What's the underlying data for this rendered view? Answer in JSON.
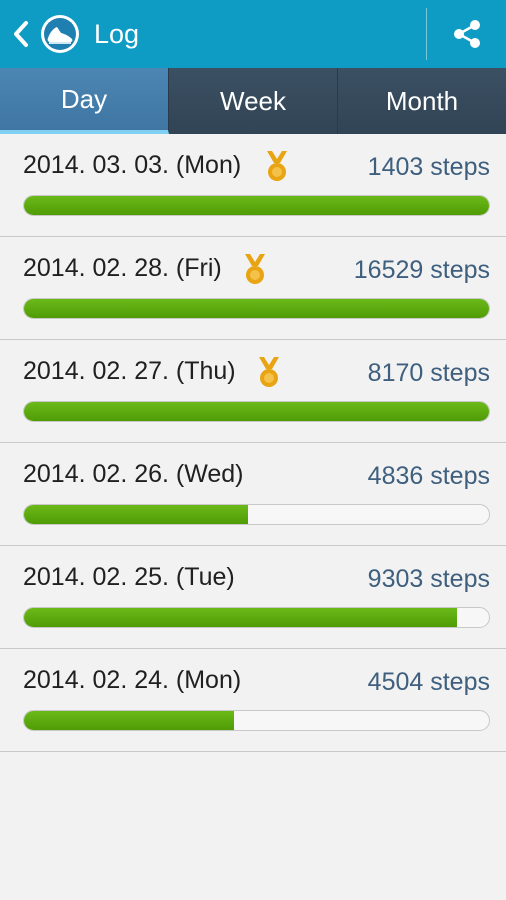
{
  "action_bar": {
    "title": "Log",
    "icons": [
      "back-icon",
      "shoe-icon",
      "share-icon"
    ],
    "color": "#0e9cc4"
  },
  "tabs": [
    {
      "label": "Day",
      "selected": true
    },
    {
      "label": "Week",
      "selected": false
    },
    {
      "label": "Month",
      "selected": false
    }
  ],
  "entries": [
    {
      "date": "2014. 03. 03. (Mon)",
      "steps": "1403 steps",
      "medal": true,
      "progress": 1.0
    },
    {
      "date": "2014. 02. 28. (Fri)",
      "steps": "16529 steps",
      "medal": true,
      "progress": 1.0
    },
    {
      "date": "2014. 02. 27. (Thu)",
      "steps": "8170 steps",
      "medal": true,
      "progress": 1.0
    },
    {
      "date": "2014. 02. 26. (Wed)",
      "steps": "4836 steps",
      "medal": false,
      "progress": 0.48
    },
    {
      "date": "2014. 02. 25. (Tue)",
      "steps": "9303 steps",
      "medal": false,
      "progress": 0.93
    },
    {
      "date": "2014. 02. 24. (Mon)",
      "steps": "4504 steps",
      "medal": false,
      "progress": 0.45
    }
  ],
  "colors": {
    "progress_green": "#5aa80d",
    "steps_text": "#3e5f7e",
    "medal": "#e8a412",
    "selected_tab": "#4a82b0"
  }
}
